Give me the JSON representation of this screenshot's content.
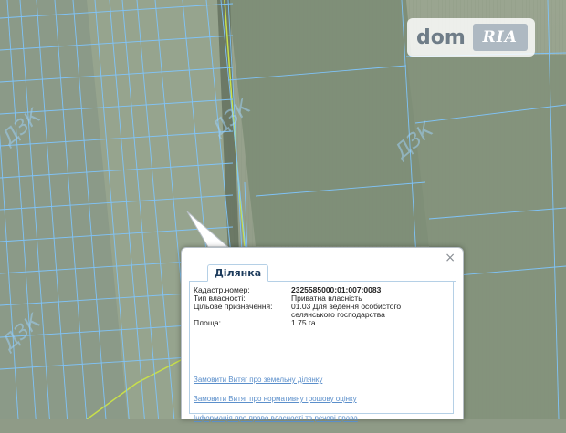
{
  "watermark": {
    "brand": "dom",
    "brand_badge": "RIA"
  },
  "map_labels": [
    "ДЗК",
    "ДЗК",
    "ДЗК",
    "ДЗК",
    "ДЗК",
    "ДЗК"
  ],
  "popup": {
    "close_glyph": "×",
    "tab_label": "Ділянка",
    "attributes": [
      {
        "key": "Кадастр.номер:",
        "value": "2325585000:01:007:0083"
      },
      {
        "key": "Тип власності:",
        "value": "Приватна власність"
      },
      {
        "key": "Цільове призначення:",
        "value": "01.03 Для ведення особистого селянського господарства"
      },
      {
        "key": "Площа:",
        "value": "1.75 га"
      }
    ],
    "links": [
      "Замовити Витяг про земельну ділянку",
      "Замовити Витяг про нормативну грошову оцінку",
      "Інформація про право власності та речові права"
    ]
  },
  "colors": {
    "parcel_line": "#7fc6ff",
    "road_line": "#c8e04a",
    "popup_tab": "#1d3b5c",
    "link": "#5b8fcb"
  }
}
